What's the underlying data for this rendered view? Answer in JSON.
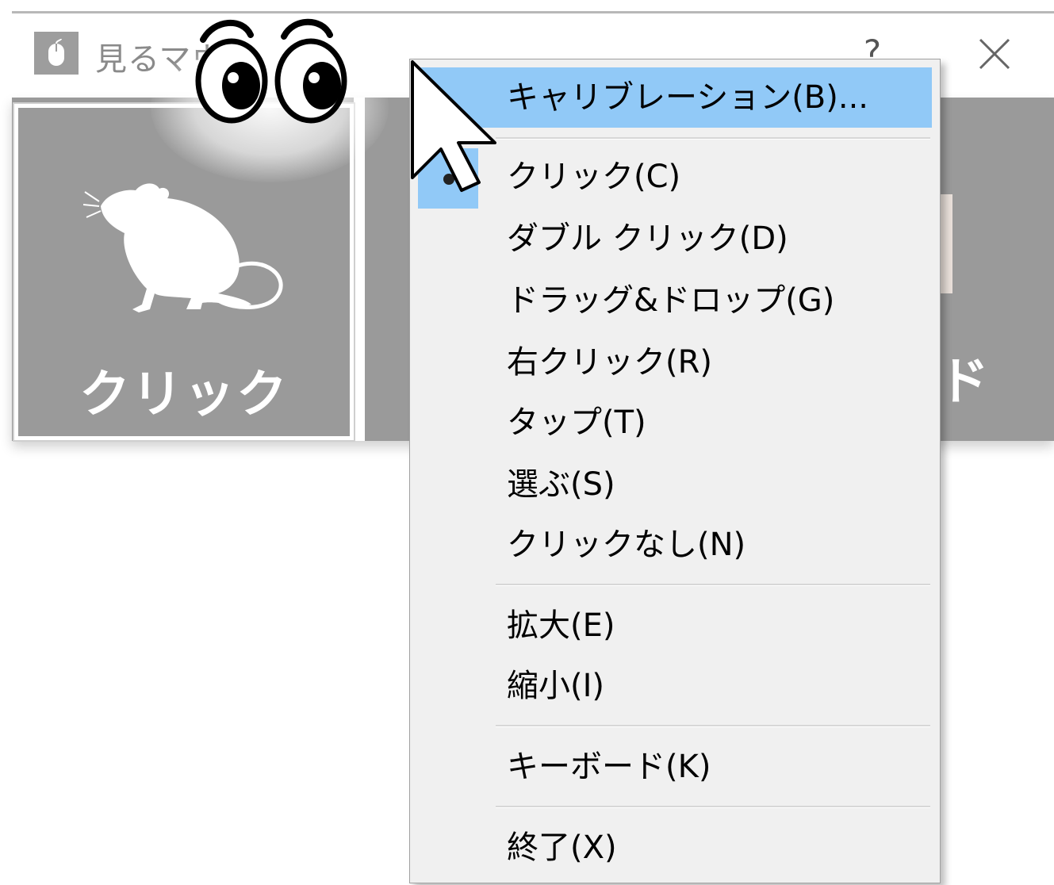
{
  "window": {
    "title": "見るマウス",
    "help_label": "?",
    "icons": [
      "mouse-icon",
      "close-icon"
    ]
  },
  "mode_cards": [
    {
      "label": "クリック",
      "icon": "mouse-animal-icon",
      "selected": true
    },
    {
      "label": "ド",
      "partially_visible": true
    }
  ],
  "context_menu": {
    "items": [
      {
        "label": "キャリブレーション(B)...",
        "highlighted": true
      },
      {
        "separator": true
      },
      {
        "label": "クリック(C)",
        "checked": true
      },
      {
        "label": "ダブル クリック(D)"
      },
      {
        "label": "ドラッグ&ドロップ(G)"
      },
      {
        "label": "右クリック(R)"
      },
      {
        "label": "タップ(T)"
      },
      {
        "label": "選ぶ(S)"
      },
      {
        "label": "クリックなし(N)"
      },
      {
        "separator": true
      },
      {
        "label": "拡大(E)"
      },
      {
        "label": "縮小(I)"
      },
      {
        "separator": true
      },
      {
        "label": "キーボード(K)"
      },
      {
        "separator": true
      },
      {
        "label": "終了(X)"
      }
    ]
  },
  "colors": {
    "highlight": "#91c9f7",
    "menu_bg": "#f0f0f0",
    "card_bg": "#9a9a9a"
  }
}
